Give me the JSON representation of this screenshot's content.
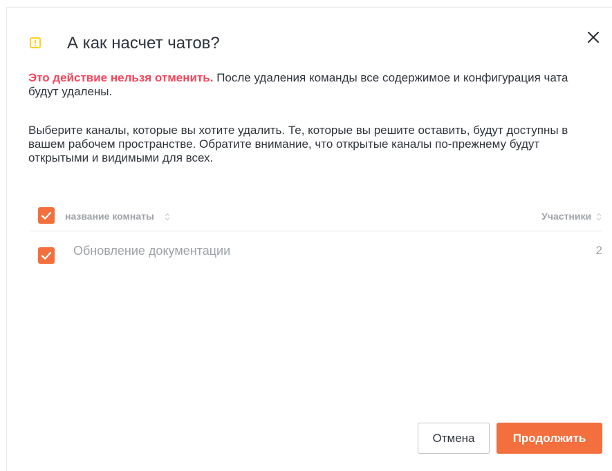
{
  "modal": {
    "title": "А как насчет чатов?",
    "warning_strong": "Это действие нельзя отменить.",
    "warning_text": " После удаления команды все содержимое и конфигурация чата будут удалены.",
    "info_text": "Выберите каналы, которые вы хотите удалить. Те, которые вы решите оставить, будут доступны в вашем рабочем пространстве. Обратите внимание, что открытые каналы по-прежнему будут открытыми и видимыми для всех.",
    "table": {
      "columns": {
        "name": "название комнаты",
        "members": "Участники"
      },
      "all_selected": true,
      "rows": [
        {
          "name": "Обновление документации",
          "members": "2",
          "selected": true
        }
      ]
    },
    "buttons": {
      "cancel": "Отмена",
      "continue": "Продолжить"
    }
  },
  "colors": {
    "accent": "#f36f3d",
    "danger": "#f5455c",
    "warning_icon": "#ffd21f"
  },
  "icons": {
    "warning": "warning-icon",
    "close": "close-icon",
    "sort": "sort-icon",
    "check": "check-icon"
  }
}
